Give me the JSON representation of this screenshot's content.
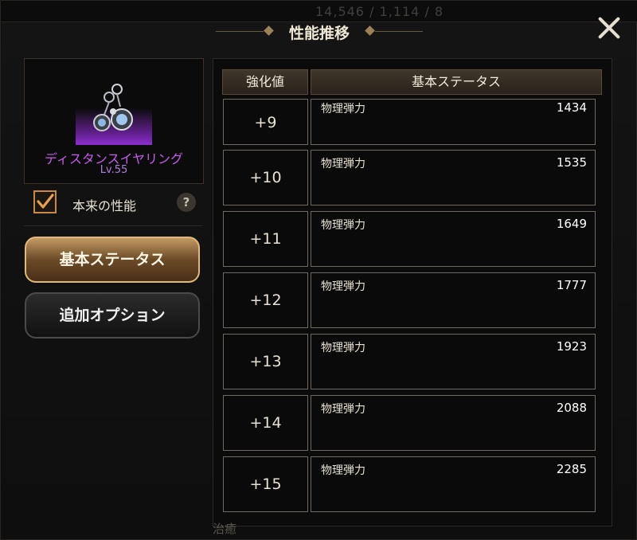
{
  "header": {
    "title": "性能推移",
    "background_ghost_text": "14,546 / 1,114 / 8"
  },
  "item": {
    "name": "ディスタンスイヤリング",
    "level": "Lv.55",
    "rarity_color": "#c85cf0"
  },
  "toggle": {
    "label": "本来の性能",
    "checked": true,
    "help": "?"
  },
  "side_buttons": [
    {
      "label": "基本ステータス",
      "active": true
    },
    {
      "label": "追加オプション",
      "active": false
    }
  ],
  "table": {
    "columns": [
      "強化値",
      "基本ステータス"
    ],
    "rows": [
      {
        "level": "+9",
        "stat": "物理弾力",
        "value": "1434"
      },
      {
        "level": "+10",
        "stat": "物理弾力",
        "value": "1535"
      },
      {
        "level": "+11",
        "stat": "物理弾力",
        "value": "1649"
      },
      {
        "level": "+12",
        "stat": "物理弾力",
        "value": "1777"
      },
      {
        "level": "+13",
        "stat": "物理弾力",
        "value": "1923"
      },
      {
        "level": "+14",
        "stat": "物理弾力",
        "value": "2088"
      },
      {
        "level": "+15",
        "stat": "物理弾力",
        "value": "2285"
      }
    ]
  },
  "footer_ghost_text": "治癒",
  "colors": {
    "accent_gold": "#c88a3f",
    "panel_border": "#6e6a62",
    "active_button": "#c39a63"
  }
}
